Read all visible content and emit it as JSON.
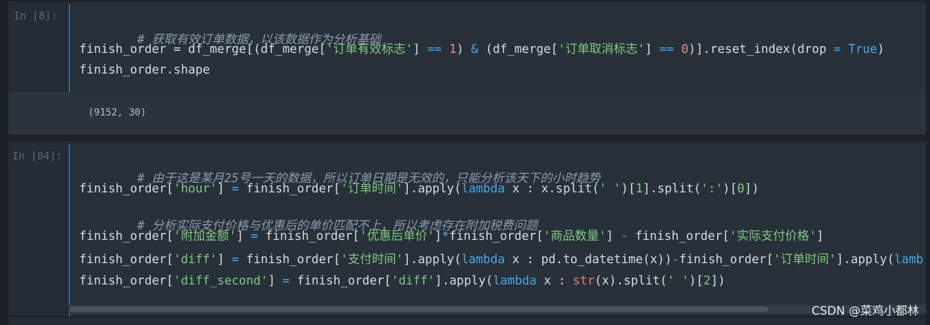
{
  "cells": [
    {
      "prompt": "In  [8]:",
      "lines": [
        "# 获取有效订单数据，以该数据作为分析基础",
        "finish_order = df_merge[(df_merge['订单有效标志'] == 1) & (df_merge['订单取消标志'] == 0)].reset_index(drop = True)",
        "finish_order.shape"
      ],
      "output": "(9152, 30)"
    },
    {
      "prompt": "In  [84]:",
      "lines": [
        "# 由于这是某月25号一天的数据，所以订单日期是无效的，只能分析该天下的小时趋势",
        "finish_order['hour'] = finish_order['订单时间'].apply(lambda x : x.split(' ')[1].split(':')[0])",
        "# 分析实际支付价格与优惠后的单价匹配不上，所以考虑存在附加税费问题",
        "finish_order['附加金额'] = finish_order['优惠后单价']*finish_order['商品数量'] - finish_order['实际支付价格']",
        "finish_order['diff'] = finish_order['支付时间'].apply(lambda x : pd.to_datetime(x))-finish_order['订单时间'].apply(lamb",
        "finish_order['diff_second'] = finish_order['diff'].apply(lambda x : str(x).split(' ')[2])"
      ]
    }
  ],
  "watermark": "CSDN @菜鸡小都林",
  "colors": {
    "background": "#1c2128",
    "cell": "#252c35",
    "output": "#2b333d",
    "accent": "#3aa0d8",
    "string": "#7fc97f",
    "keyword": "#4aa8e8",
    "number": "#e38b8b",
    "comment": "#8d9aac"
  }
}
